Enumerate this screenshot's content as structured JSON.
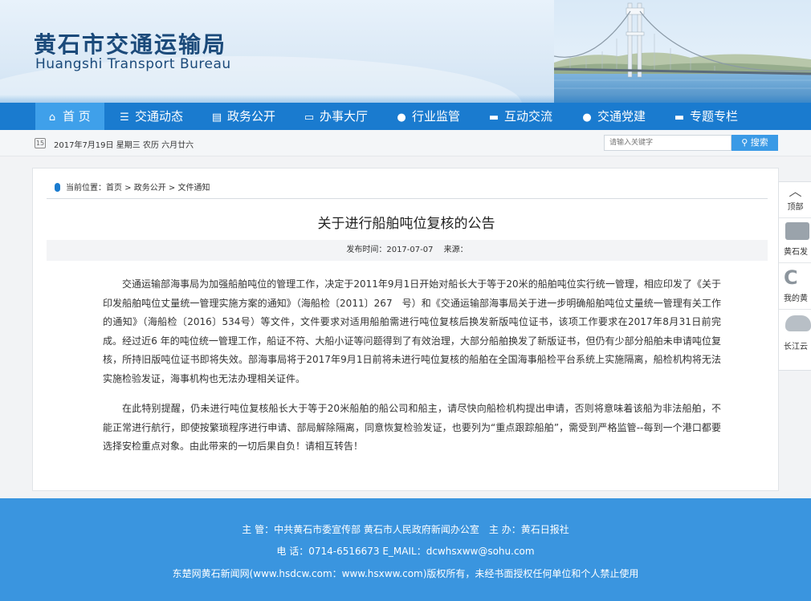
{
  "header": {
    "title_cn": "黄石市交通运输局",
    "title_en": "Huangshi Transport Bureau",
    "bridge_sign": "黄石长江大桥"
  },
  "nav": {
    "items": [
      {
        "label": "首 页",
        "icon": "home-icon"
      },
      {
        "label": "交通动态",
        "icon": "list-icon"
      },
      {
        "label": "政务公开",
        "icon": "document-icon"
      },
      {
        "label": "办事大厅",
        "icon": "monitor-icon"
      },
      {
        "label": "行业监管",
        "icon": "shield-icon"
      },
      {
        "label": "互动交流",
        "icon": "chat-icon"
      },
      {
        "label": "交通党建",
        "icon": "user-icon"
      },
      {
        "label": "专题专栏",
        "icon": "message-icon"
      }
    ]
  },
  "subbar": {
    "date": "2017年7月19日 星期三 农历 六月廿六",
    "search_placeholder": "请输入关键字",
    "search_button": "搜索"
  },
  "breadcrumb": {
    "label": "当前位置：",
    "items": [
      "首页",
      "政务公开",
      "文件通知"
    ]
  },
  "article": {
    "title": "关于进行船舶吨位复核的公告",
    "meta": "发布时间：2017-07-07　 来源：",
    "paragraphs": [
      "交通运输部海事局为加强船舶吨位的管理工作，决定于2011年9月1日开始对船长大于等于20米的船舶吨位实行统一管理，相应印发了《关于印发船舶吨位丈量统一管理实施方案的通知》（海船检〔2011〕267　号）和《交通运输部海事局关于进一步明确船舶吨位丈量统一管理有关工作的通知》（海船检〔2016〕534号）等文件，文件要求对适用船舶需进行吨位复核后换发新版吨位证书，该项工作要求在2017年8月31日前完成。经过近6 年的吨位统一管理工作，船证不符、大船小证等问题得到了有效治理，大部分船舶换发了新版证书，但仍有少部分船舶未申请吨位复核，所持旧版吨位证书即将失效。部海事局将于2017年9月1日前将未进行吨位复核的船舶在全国海事船检平台系统上实施隔离，船检机构将无法实施检验发证，海事机构也无法办理相关证件。",
      "在此特别提醒，仍未进行吨位复核船长大于等于20米船舶的船公司和船主，请尽快向船检机构提出申请，否则将意味着该船为非法船舶，不能正常进行航行，即使按繁琐程序进行申请、部局解除隔离，同意恢复检验发证，也要列为“重点跟踪船舶”，需受到严格监管--每到一个港口都要选择安检重点对象。由此带来的一切后果自负！请相互转告！"
    ]
  },
  "side": {
    "items": [
      {
        "label": "顶部",
        "icon": "chevron-up-icon"
      },
      {
        "label": "黄石发",
        "icon": "paper-icon"
      },
      {
        "label": "我的黄",
        "icon": "swirl-icon"
      },
      {
        "label": "长江云",
        "icon": "cloud-icon"
      }
    ]
  },
  "footer": {
    "line1": "主 管：中共黄石市委宣传部 黄石市人民政府新闻办公室　主 办：黄石日报社",
    "line2": "电 话：0714-6516673 E_MAIL：dcwhsxww@sohu.com",
    "line3": "东楚网黄石新闻网(www.hsdcw.com：www.hsxww.com)版权所有，未经书面授权任何单位和个人禁止使用"
  },
  "colors": {
    "nav_bg": "#1a7bcf",
    "nav_active": "#3fa0ea",
    "footer_bg": "#3a95df",
    "title_blue": "#1b4a7a"
  }
}
